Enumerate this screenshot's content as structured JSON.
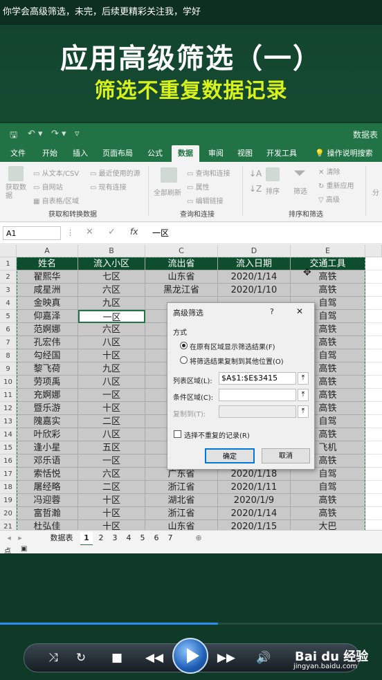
{
  "caption": "你学会高级筛选，未完，后续更精彩关注我，学好",
  "hero": {
    "title": "应用高级筛选（一）",
    "subtitle": "筛选不重复数据记录"
  },
  "excel": {
    "workbook_name": "数据表",
    "tabs": [
      "文件",
      "开始",
      "插入",
      "页面布局",
      "公式",
      "数据",
      "审阅",
      "视图",
      "开发工具",
      "操作说明搜索"
    ],
    "active_tab": "数据",
    "ribbon": {
      "get_data": "获取数据",
      "from_text": "从文本/CSV",
      "recent_sources": "最近使用的源",
      "from_web": "自网站",
      "existing_conn": "现有连接",
      "from_table": "自表格/区域",
      "group1": "获取和转换数据",
      "refresh_all": "全部刷新",
      "queries_conn": "查询和连接",
      "properties": "属性",
      "edit_links": "编辑链接",
      "group2": "查询和连接",
      "sort": "排序",
      "filter": "筛选",
      "clear": "清除",
      "reapply": "重新应用",
      "advanced": "高级",
      "group3": "排序和筛选",
      "split": "分"
    },
    "namebox": "A1",
    "fx": "fx",
    "formula": "一区",
    "columns": [
      "A",
      "B",
      "C",
      "D",
      "E"
    ],
    "headers": [
      "姓名",
      "流入小区",
      "流出省",
      "流入日期",
      "交通工具"
    ],
    "rows": [
      [
        "翟熙华",
        "七区",
        "山东省",
        "2020/1/14",
        "高铁"
      ],
      [
        "咸星洲",
        "六区",
        "黑龙江省",
        "2020/1/10",
        "高铁"
      ],
      [
        "金映真",
        "九区",
        "",
        "",
        "自驾"
      ],
      [
        "仰嘉泽",
        "一区",
        "",
        "",
        "自驾"
      ],
      [
        "范婀娜",
        "六区",
        "",
        "",
        "高铁"
      ],
      [
        "孔宏伟",
        "八区",
        "",
        "",
        "高铁"
      ],
      [
        "勾经国",
        "十区",
        "",
        "",
        "自驾"
      ],
      [
        "黎飞荷",
        "九区",
        "",
        "",
        "高铁"
      ],
      [
        "劳项禹",
        "八区",
        "",
        "",
        "高铁"
      ],
      [
        "充婀娜",
        "一区",
        "",
        "",
        "高铁"
      ],
      [
        "暨乐游",
        "十区",
        "",
        "",
        "高铁"
      ],
      [
        "隗嘉实",
        "二区",
        "",
        "",
        "自驾"
      ],
      [
        "叶欣彩",
        "八区",
        "",
        "",
        "高铁"
      ],
      [
        "逢小星",
        "五区",
        "",
        "",
        "飞机"
      ],
      [
        "邓乐语",
        "一区",
        "",
        "",
        "高铁"
      ],
      [
        "索恬悦",
        "六区",
        "广东省",
        "2020/1/18",
        "自驾"
      ],
      [
        "屠经略",
        "二区",
        "浙江省",
        "2020/1/11",
        "自驾"
      ],
      [
        "冯迎蓉",
        "十区",
        "湖北省",
        "2020/1/9",
        "高铁"
      ],
      [
        "富哲瀚",
        "十区",
        "浙江省",
        "2020/1/14",
        "高铁"
      ],
      [
        "杜弘佳",
        "十区",
        "山东省",
        "2020/1/15",
        "大巴"
      ]
    ],
    "row_numbers": [
      "1",
      "2",
      "3",
      "4",
      "5",
      "6",
      "7",
      "8",
      "9",
      "10",
      "11",
      "12",
      "13",
      "14",
      "15",
      "16",
      "17",
      "18",
      "19",
      "20",
      "21"
    ],
    "sheet_tabs": [
      "数据表",
      "1",
      "2",
      "3",
      "4",
      "5",
      "6",
      "7"
    ],
    "active_sheet": "1",
    "status_text": "点"
  },
  "dialog": {
    "title": "高级筛选",
    "help": "?",
    "close": "✕",
    "method_label": "方式",
    "option1": "在原有区域显示筛选结果(F)",
    "option2": "将筛选结果复制到其他位置(O)",
    "list_range_label": "列表区域(L):",
    "list_range_value": "$A$1:$E$3415",
    "criteria_label": "条件区域(C):",
    "criteria_value": "",
    "copy_to_label": "复制到(T):",
    "unique_label": "选择不重复的记录(R)",
    "ok": "确定",
    "cancel": "取消"
  },
  "player": {
    "progress": 0.57,
    "brand": "Bai du 经验",
    "url": "jingyan.baidu.com"
  }
}
